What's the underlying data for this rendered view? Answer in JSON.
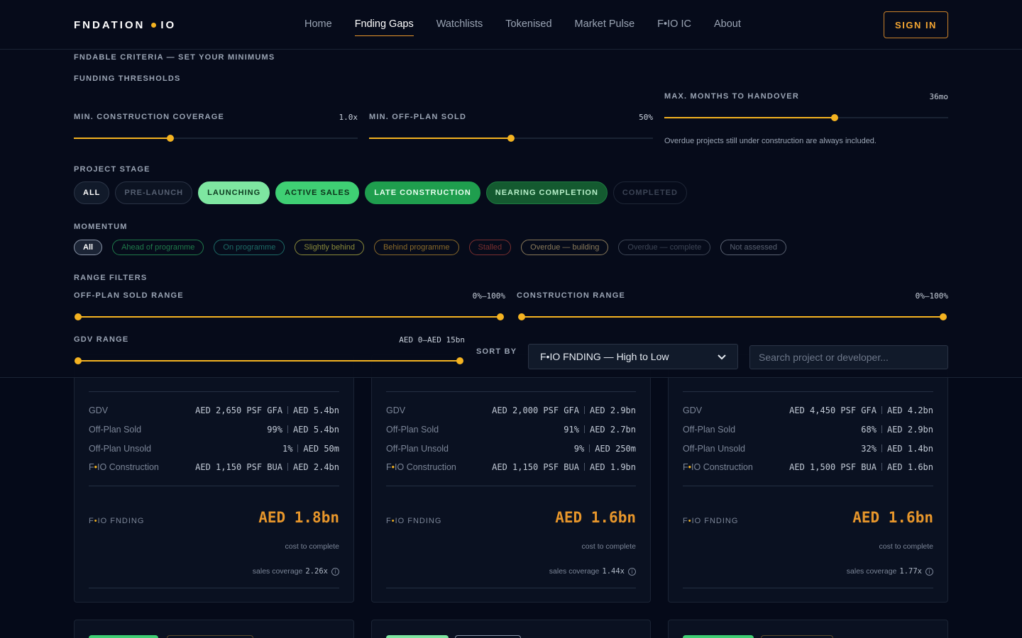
{
  "nav": {
    "brand_left": "FNDATION",
    "brand_right": "IO",
    "links": [
      {
        "label": "Home",
        "active": false
      },
      {
        "label": "Fnding Gaps",
        "active": true
      },
      {
        "label": "Watchlists",
        "active": false
      },
      {
        "label": "Tokenised",
        "active": false
      },
      {
        "label": "Market Pulse",
        "active": false
      },
      {
        "label": "F•IO IC",
        "active": false
      },
      {
        "label": "About",
        "active": false
      }
    ],
    "signin": "SIGN IN"
  },
  "filters": {
    "criteria_heading": "FNDABLE CRITERIA — SET YOUR MINIMUMS",
    "thresholds_heading": "FUNDING THRESHOLDS",
    "min_construction_coverage": {
      "label": "MIN. CONSTRUCTION COVERAGE",
      "value": "1.0x",
      "fraction": 0.34
    },
    "min_off_plan_sold": {
      "label": "MIN. OFF-PLAN SOLD",
      "value": "50%",
      "fraction": 0.5
    },
    "max_months_to_handover": {
      "label": "MAX. MONTHS TO HANDOVER",
      "value": "36mo",
      "fraction": 0.6,
      "note": "Overdue projects still under construction are always included."
    },
    "project_stage": {
      "heading": "PROJECT STAGE",
      "chips": [
        "ALL",
        "PRE-LAUNCH",
        "LAUNCHING",
        "ACTIVE SALES",
        "LATE CONSTRUCTION",
        "NEARING COMPLETION",
        "COMPLETED"
      ]
    },
    "momentum": {
      "heading": "MOMENTUM",
      "chips": [
        {
          "label": "All",
          "color": "#ffffff"
        },
        {
          "label": "Ahead of programme",
          "color": "#1f7a4a"
        },
        {
          "label": "On programme",
          "color": "#1d6a66"
        },
        {
          "label": "Slightly behind",
          "color": "#8a8a3a"
        },
        {
          "label": "Behind programme",
          "color": "#8a6a2a"
        },
        {
          "label": "Stalled",
          "color": "#7a2f2f"
        },
        {
          "label": "Overdue — building",
          "color": "#8a7a5a"
        },
        {
          "label": "Overdue — complete",
          "color": "#3e4656"
        },
        {
          "label": "Not assessed",
          "color": "#5a6272"
        }
      ]
    },
    "range": {
      "heading": "RANGE FILTERS",
      "off_plan_sold": {
        "label": "OFF-PLAN SOLD RANGE",
        "value": "0%–100%",
        "min": 0,
        "max": 1
      },
      "construction": {
        "label": "CONSTRUCTION RANGE",
        "value": "0%–100%",
        "min": 0,
        "max": 1
      },
      "gdv": {
        "label": "GDV RANGE",
        "value": "AED 0–AED 15bn",
        "min": 0,
        "max": 1
      }
    },
    "sort_label": "SORT BY",
    "sort_value": "F•IO FNDING — High to Low",
    "search_placeholder": "Search project or developer..."
  },
  "cards": [
    {
      "gdv": {
        "label": "GDV",
        "a": "AED 2,650 PSF GFA",
        "b": "AED 5.4bn"
      },
      "sold": {
        "label": "Off-Plan Sold",
        "a": "99%",
        "b": "AED 5.4bn"
      },
      "unsold": {
        "label": "Off-Plan Unsold",
        "a": "1%",
        "b": "AED 50m"
      },
      "construction": {
        "label_a": "F",
        "label_b": "IO Construction",
        "a": "AED 1,150 PSF BUA",
        "b": "AED 2.4bn"
      },
      "funding_label_a": "F",
      "funding_label_b": "IO FNDING",
      "funding": "AED 1.8bn",
      "ctc": "cost to complete",
      "coverage_label": "sales coverage",
      "coverage": "2.26x"
    },
    {
      "gdv": {
        "label": "GDV",
        "a": "AED 2,000 PSF GFA",
        "b": "AED 2.9bn"
      },
      "sold": {
        "label": "Off-Plan Sold",
        "a": "91%",
        "b": "AED 2.7bn"
      },
      "unsold": {
        "label": "Off-Plan Unsold",
        "a": "9%",
        "b": "AED 250m"
      },
      "construction": {
        "label_a": "F",
        "label_b": "IO Construction",
        "a": "AED 1,150 PSF BUA",
        "b": "AED 1.9bn"
      },
      "funding_label_a": "F",
      "funding_label_b": "IO FNDING",
      "funding": "AED 1.6bn",
      "ctc": "cost to complete",
      "coverage_label": "sales coverage",
      "coverage": "1.44x"
    },
    {
      "gdv": {
        "label": "GDV",
        "a": "AED 4,450 PSF GFA",
        "b": "AED 4.2bn"
      },
      "sold": {
        "label": "Off-Plan Sold",
        "a": "68%",
        "b": "AED 2.9bn"
      },
      "unsold": {
        "label": "Off-Plan Unsold",
        "a": "32%",
        "b": "AED 1.4bn"
      },
      "construction": {
        "label_a": "F",
        "label_b": "IO Construction",
        "a": "AED 1,500 PSF BUA",
        "b": "AED 1.6bn"
      },
      "funding_label_a": "F",
      "funding_label_b": "IO FNDING",
      "funding": "AED 1.6bn",
      "ctc": "cost to complete",
      "coverage_label": "sales coverage",
      "coverage": "1.77x"
    }
  ],
  "colors": {
    "accent": "#f4b321",
    "accent_orange": "#e7962b",
    "background": "#050a19"
  }
}
